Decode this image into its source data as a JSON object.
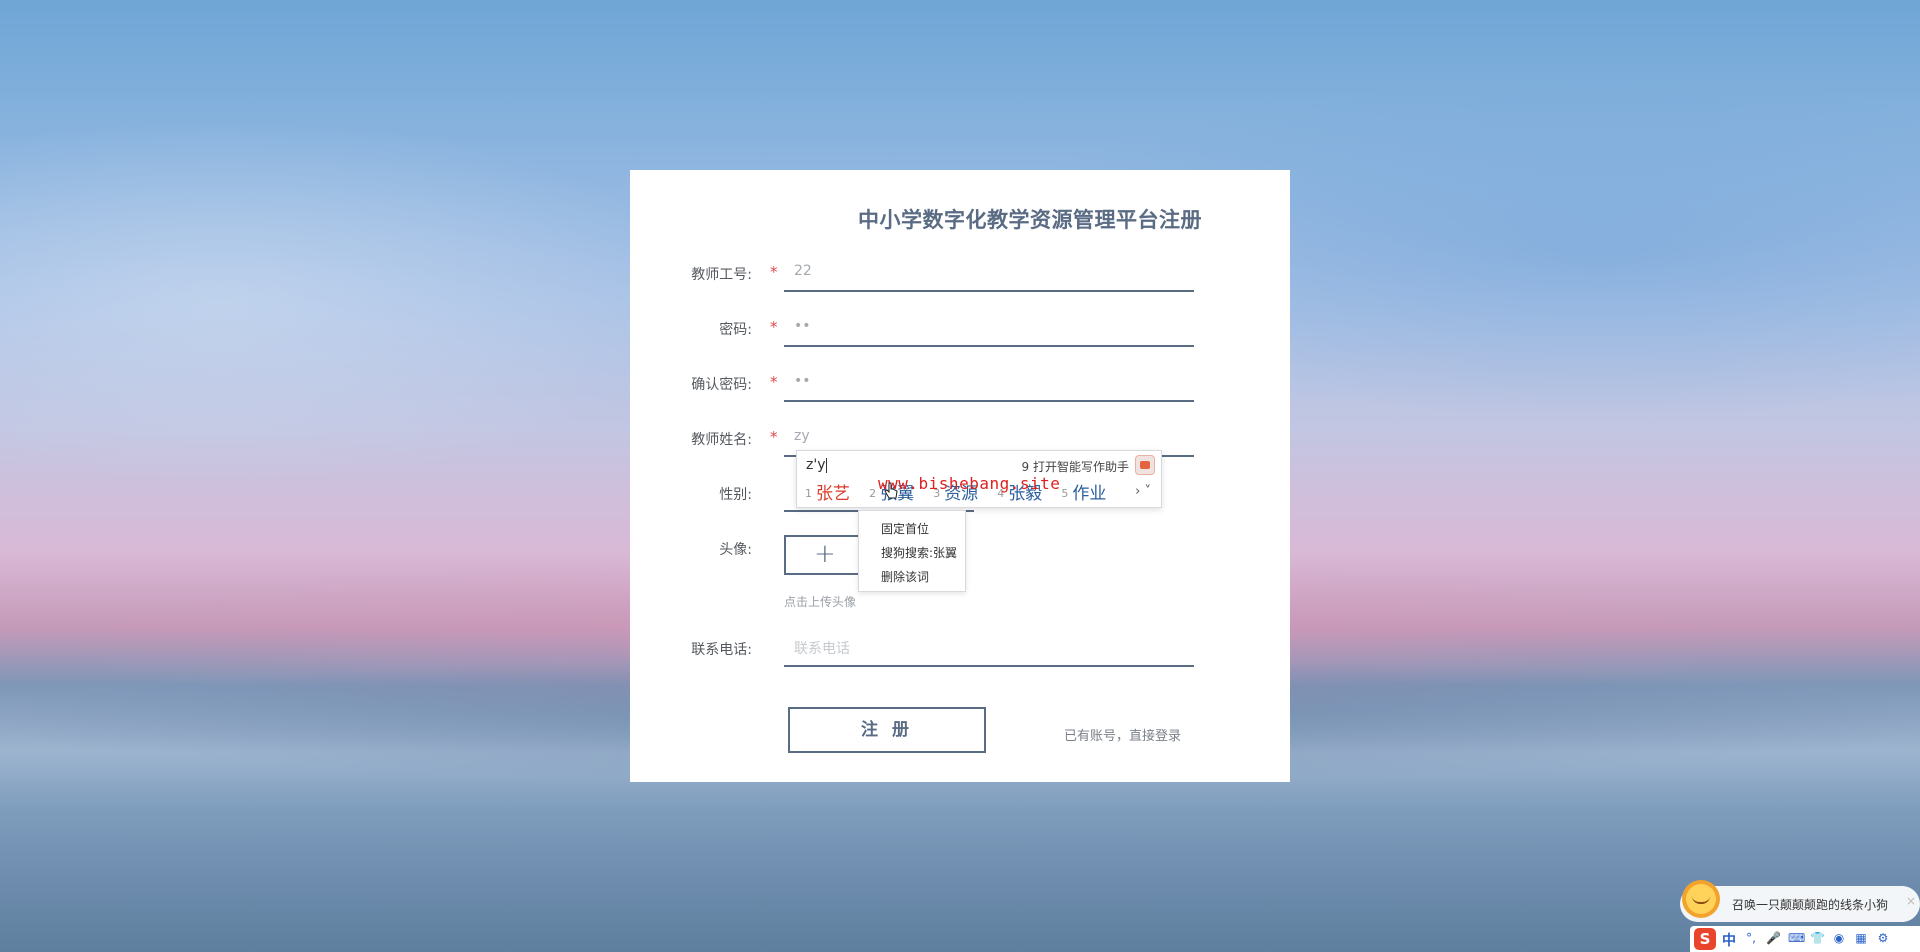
{
  "form": {
    "title": "中小学数字化教学资源管理平台注册",
    "fields": [
      {
        "label": "教师工号:",
        "required": true,
        "value": "22"
      },
      {
        "label": "密码:",
        "required": true,
        "value": "••"
      },
      {
        "label": "确认密码:",
        "required": true,
        "value": "••"
      },
      {
        "label": "教师姓名:",
        "required": true,
        "value": "zy"
      },
      {
        "label": "性别:",
        "required": false,
        "value": ""
      }
    ],
    "required_mark": "*",
    "avatar_label": "头像:",
    "avatar_plus": "+",
    "avatar_hint": "点击上传头像",
    "phone_label": "联系电话:",
    "phone_placeholder": "联系电话",
    "register_button": "注 册",
    "login_link": "已有账号，直接登录"
  },
  "ime": {
    "input": "z'y",
    "assist": "9 打开智能写作助手",
    "candidates": [
      {
        "num": "1",
        "text": "张艺"
      },
      {
        "num": "2",
        "text": "张翼"
      },
      {
        "num": "3",
        "text": "资源"
      },
      {
        "num": "4",
        "text": "张毅"
      },
      {
        "num": "5",
        "text": "作业"
      }
    ],
    "nav": "›  ˅",
    "context_menu": [
      "固定首位",
      "搜狗搜索:张翼",
      "删除该词"
    ]
  },
  "watermark": "www.bishebang.site",
  "widget": {
    "pet_text": "召唤一只颠颠颠跑的线条小狗",
    "pet_close": "×",
    "ime_logo": "S",
    "ime_mode": "中"
  },
  "colors": {
    "accent": "#5a6b84",
    "required": "#e0484b",
    "candidate_first": "#d93b2b",
    "candidate": "#2d5f9c"
  }
}
